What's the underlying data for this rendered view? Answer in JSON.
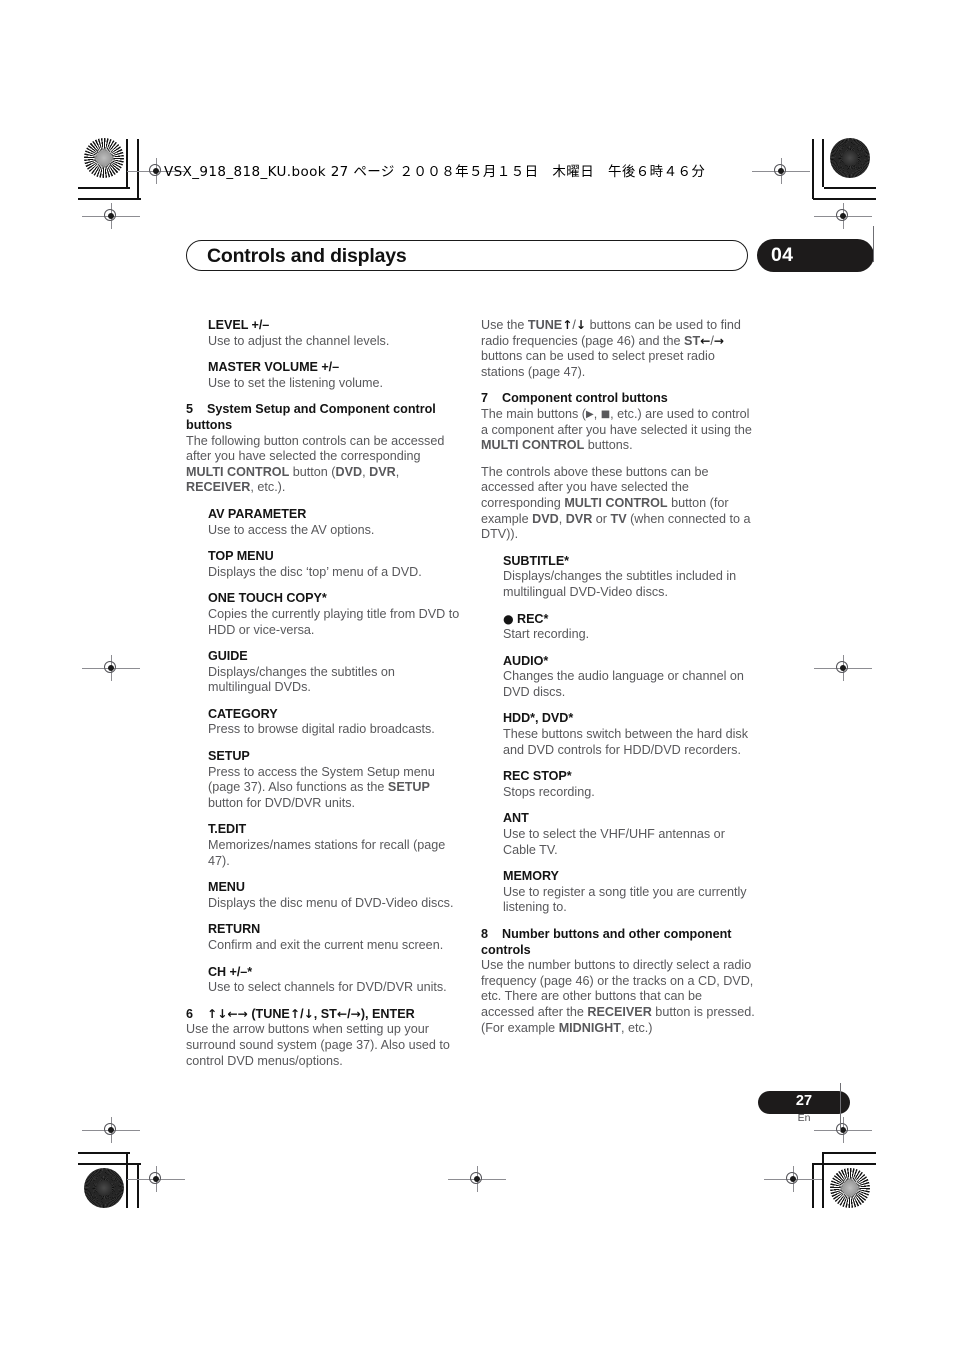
{
  "header": {
    "file_line": "VSX_918_818_KU.book  27 ページ  ２００８年５月１５日　木曜日　午後６時４６分"
  },
  "banner": {
    "title": "Controls and displays",
    "chapter_number": "04"
  },
  "footer": {
    "page_number": "27",
    "language": "En"
  },
  "left_column": [
    {
      "term": "LEVEL +/–",
      "desc": "Use to adjust the channel levels.",
      "indent": true
    },
    {
      "term": "MASTER VOLUME +/–",
      "desc": "Use to set the listening volume.",
      "indent": true
    },
    {
      "section_number": "5",
      "section_title": "System Setup and Component control buttons",
      "desc_html": "The following button controls can be accessed after you have selected the corresponding <b>MULTI CONTROL</b> button (<b>DVD</b>, <b>DVR</b>, <b>RECEIVER</b>, etc.).",
      "indent": false
    },
    {
      "term": "AV PARAMETER",
      "desc": "Use to access the AV options.",
      "indent": true
    },
    {
      "term": "TOP MENU",
      "desc": "Displays the disc ‘top’ menu of a DVD.",
      "indent": true
    },
    {
      "term": "ONE TOUCH COPY*",
      "desc": "Copies the currently playing title from DVD to HDD or vice-versa.",
      "indent": true
    },
    {
      "term": "GUIDE",
      "desc": "Displays/changes the subtitles on multilingual DVDs.",
      "indent": true
    },
    {
      "term": "CATEGORY",
      "desc": "Press to browse digital radio broadcasts.",
      "indent": true
    },
    {
      "term": "SETUP",
      "desc_html": "Press to access the System Setup menu (page 37). Also functions as the <b>SETUP</b> button for DVD/DVR units.",
      "indent": true
    },
    {
      "term": "T.EDIT",
      "desc": "Memorizes/names stations for recall (page 47).",
      "indent": true
    },
    {
      "term": "MENU",
      "desc": "Displays the disc menu of DVD-Video discs.",
      "indent": true
    },
    {
      "term": "RETURN",
      "desc": "Confirm and exit the current menu screen.",
      "indent": true
    },
    {
      "term": "CH +/–*",
      "desc": "Use to select channels for DVD/DVR units.",
      "indent": true
    },
    {
      "section_number": "6",
      "section_title_html": "<span class=\"glyph\">↑↓←→</span> (TUNE<span class=\"glyph\">↑</span>/<span class=\"glyph\">↓</span>, ST<span class=\"glyph\">←</span>/<span class=\"glyph\">→</span>), ENTER",
      "section_title_plain": "↑↓←→ (TUNE↑/↓, ST←/→), ENTER",
      "desc": "Use the arrow buttons when setting up your surround sound system (page 37). Also used to control DVD menus/options.",
      "indent": false
    }
  ],
  "right_column": [
    {
      "desc_html": "Use the <b>TUNE</b><span class=\"glyph\">↑</span>/<span class=\"glyph\">↓</span> buttons can be used to find radio frequencies (page 46) and the <b>ST</b><span class=\"glyph\">←</span>/<span class=\"glyph\">→</span> buttons can be used to select preset radio stations (page 47).",
      "indent": false
    },
    {
      "section_number": "7",
      "section_title": "Component control buttons",
      "desc_html": "The main buttons (<span class=\"glyph-sm\">▶</span>, <span class=\"glyph-sm\">■</span>, etc.) are used to control a component after you have selected it using the <b>MULTI CONTROL</b> buttons.",
      "indent": false
    },
    {
      "desc_html": "The controls above these buttons can be accessed after you have selected the corresponding <b>MULTI CONTROL</b> button (for example <b>DVD</b>, <b>DVR</b> or <b>TV</b> (when connected to a DTV)).",
      "indent": false
    },
    {
      "term": "SUBTITLE*",
      "desc": "Displays/changes the subtitles included in multilingual DVD-Video discs.",
      "indent": true
    },
    {
      "term_html": "<span class=\"glyph\">●</span> REC*",
      "term": "● REC*",
      "desc": "Start recording.",
      "indent": true
    },
    {
      "term": "AUDIO*",
      "desc": "Changes the audio language or channel on DVD discs.",
      "indent": true
    },
    {
      "term": "HDD*, DVD*",
      "desc": "These buttons switch between the hard disk and DVD controls for HDD/DVD recorders.",
      "indent": true
    },
    {
      "term": "REC STOP*",
      "desc": "Stops recording.",
      "indent": true
    },
    {
      "term": "ANT",
      "desc": "Use to select the VHF/UHF antennas or Cable TV.",
      "indent": true
    },
    {
      "term": "MEMORY",
      "desc": "Use to register a song title you are currently listening to.",
      "indent": true
    },
    {
      "section_number": "8",
      "section_title": "Number buttons and other component controls",
      "desc_html": "Use the number buttons to directly select a radio frequency (page 46) or the tracks on a CD, DVD, etc. There are other buttons that can be accessed after the <b>RECEIVER</b> button is pressed. (For example <b>MIDNIGHT</b>, etc.)",
      "indent": false
    }
  ]
}
